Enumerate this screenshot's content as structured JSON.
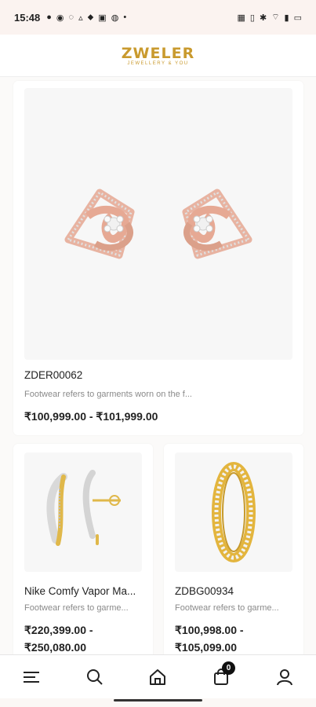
{
  "statusbar": {
    "time": "15:48",
    "left_icons": [
      "message-icon",
      "lens-icon",
      "whatsapp-icon",
      "drive-icon",
      "location-icon",
      "gallery-icon",
      "github-icon",
      "dot-icon"
    ],
    "right_icons": [
      "nfc-icon",
      "vibrate-icon",
      "bluetooth-icon",
      "wifi-icon",
      "signal-icon",
      "battery-icon"
    ]
  },
  "header": {
    "brand": "ZWELER",
    "tagline": "JEWELLERY & YOU"
  },
  "products": [
    {
      "title": "ZDER00062",
      "description": "Footwear refers to garments worn on the f...",
      "price": "₹100,999.00 - ₹101,999.00",
      "image_icon": "rose-gold-earrings-icon"
    },
    {
      "title": "Nike Comfy Vapor Ma...",
      "description": "Footwear refers to garme...",
      "price_line1": "₹220,399.00 -",
      "price_line2": "₹250,080.00",
      "image_icon": "two-tone-earrings-icon"
    },
    {
      "title": "ZDBG00934",
      "description": "Footwear refers to garme...",
      "price_line1": "₹100,998.00 -",
      "price_line2": "₹105,099.00",
      "image_icon": "gold-band-ring-icon"
    }
  ],
  "bottom_nav": {
    "cart_count": "0",
    "items": [
      "menu-icon",
      "search-icon",
      "home-icon",
      "cart-icon",
      "profile-icon"
    ]
  },
  "colors": {
    "brand_gold": "#c99a2e",
    "rose_gold": "#e8b3a1",
    "badge_bg": "#111111"
  }
}
